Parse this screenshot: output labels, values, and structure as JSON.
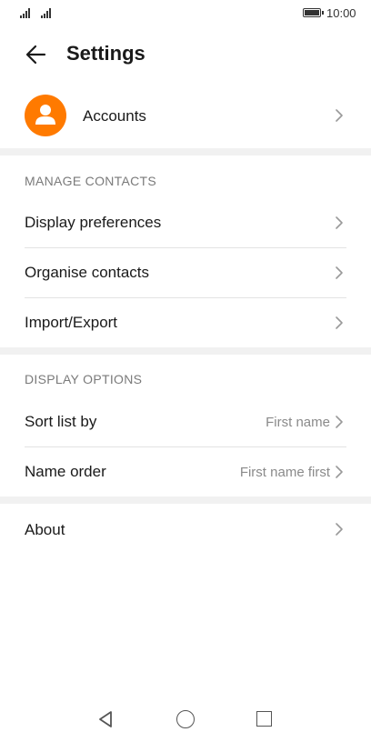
{
  "status_bar": {
    "time": "10:00"
  },
  "header": {
    "title": "Settings"
  },
  "accounts": {
    "label": "Accounts"
  },
  "manage_contacts": {
    "section_title": "MANAGE CONTACTS",
    "items": [
      {
        "label": "Display preferences"
      },
      {
        "label": "Organise contacts"
      },
      {
        "label": "Import/Export"
      }
    ]
  },
  "display_options": {
    "section_title": "DISPLAY OPTIONS",
    "items": [
      {
        "label": "Sort list by",
        "value": "First name"
      },
      {
        "label": "Name order",
        "value": "First name first"
      }
    ]
  },
  "about": {
    "label": "About"
  },
  "colors": {
    "accent": "#ff7a00",
    "divider": "#f1f1f1",
    "secondary_text": "#8a8a8a"
  }
}
